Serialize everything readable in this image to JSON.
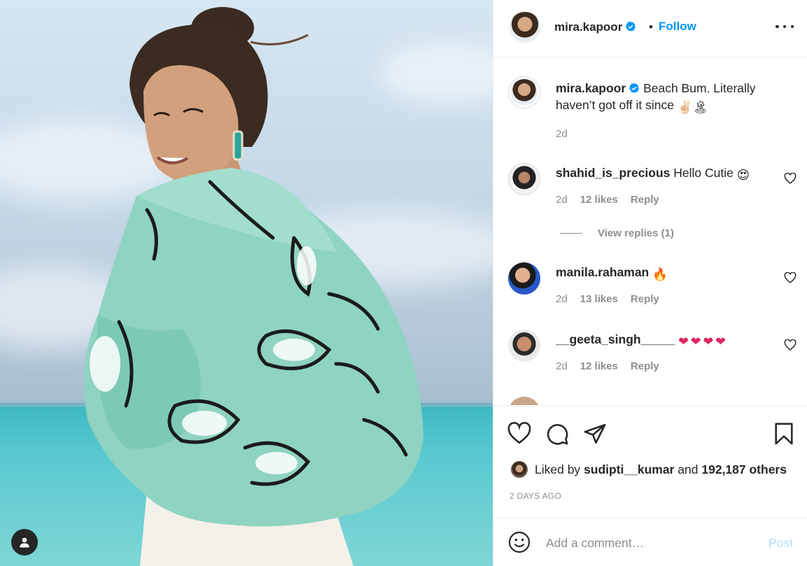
{
  "post": {
    "author": "mira.kapoor",
    "follow_label": "Follow",
    "separator": "•"
  },
  "caption": {
    "username": "mira.kapoor",
    "text": "Beach Bum. Literally haven’t got off it since",
    "emoji": "✌🏻🏝",
    "time": "2d"
  },
  "comments": [
    {
      "username": "shahid_is_precious",
      "text": "Hello Cutie",
      "emoji": "😍",
      "time": "2d",
      "likes": "12 likes",
      "reply": "Reply",
      "view_replies": "View replies (1)"
    },
    {
      "username": "manila.rahaman",
      "text": "",
      "emoji": "🔥",
      "time": "2d",
      "likes": "13 likes",
      "reply": "Reply"
    },
    {
      "username": "__geeta_singh_____",
      "text": "",
      "emoji": "❤❤❤❤",
      "time": "2d",
      "likes": "12 likes",
      "reply": "Reply"
    }
  ],
  "likes": {
    "prefix": "Liked by",
    "user": "sudipti__kumar",
    "middle": "and",
    "count": "192,187 others"
  },
  "timestamp": "2 DAYS AGO",
  "add_comment": {
    "placeholder": "Add a comment…",
    "post_label": "Post"
  },
  "colors": {
    "link": "#0095f6",
    "post_disabled": "#b2dffc",
    "secondary_text": "#8e8e8e",
    "heart_red": "#ed4956"
  },
  "icons": [
    "verified-badge-icon",
    "more-options-icon",
    "heart-icon",
    "comment-icon",
    "share-icon",
    "bookmark-icon",
    "emoji-icon",
    "user-tag-icon"
  ]
}
